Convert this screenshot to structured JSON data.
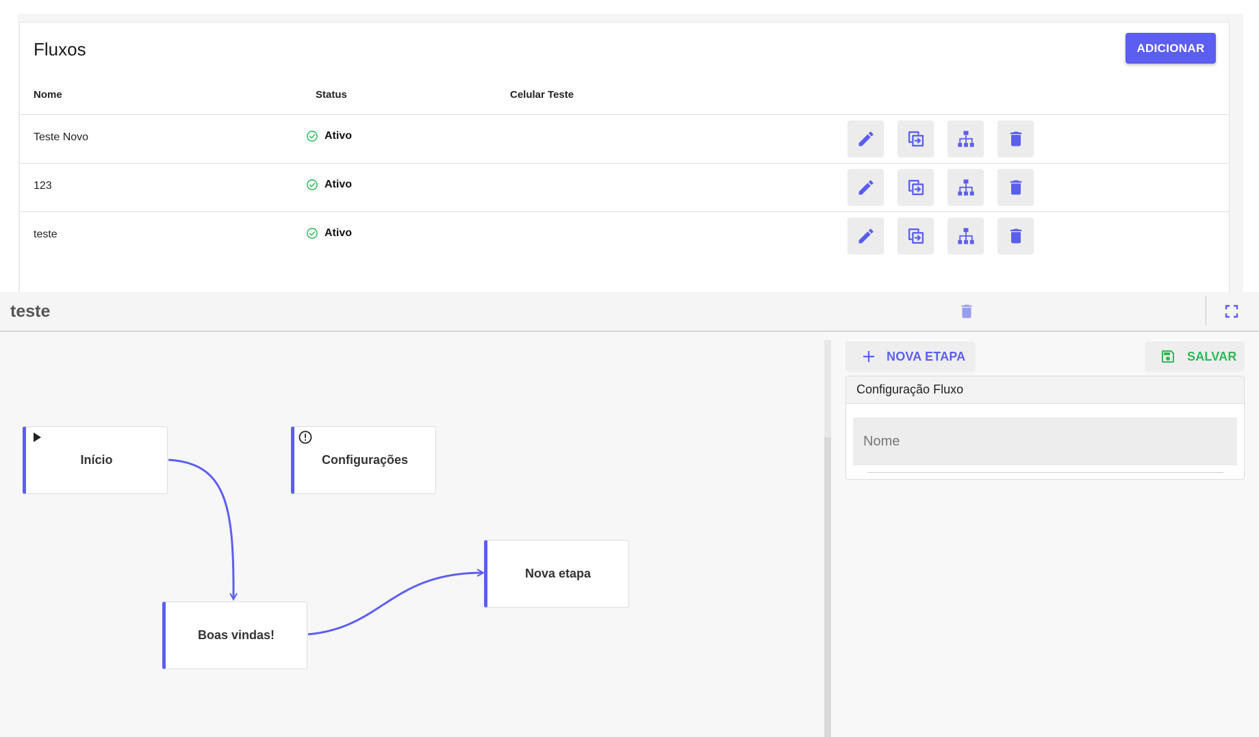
{
  "flows_page": {
    "title": "Fluxos",
    "add_label": "ADICIONAR",
    "columns": {
      "name": "Nome",
      "status": "Status",
      "test_phone": "Celular Teste"
    },
    "rows": [
      {
        "name": "Teste Novo",
        "status": "Ativo",
        "test_phone": ""
      },
      {
        "name": "123",
        "status": "Ativo",
        "test_phone": ""
      },
      {
        "name": "teste",
        "status": "Ativo",
        "test_phone": ""
      }
    ],
    "row_actions": [
      "edit-icon",
      "duplicate-icon",
      "sitemap-icon",
      "trash-icon"
    ]
  },
  "editor": {
    "title": "teste",
    "header_icons": [
      "trash-icon",
      "fullscreen-icon"
    ],
    "nodes": {
      "start": "Início",
      "settings": "Configurações",
      "welcome": "Boas vindas!",
      "new_step": "Nova etapa"
    },
    "new_step_label": "NOVA ETAPA",
    "save_label": "SALVAR",
    "config_title": "Configuração Fluxo",
    "name_placeholder": "Nome"
  },
  "colors": {
    "accent": "#5c5ef0",
    "success": "#2db85a",
    "status_ok": "#3cbf64"
  }
}
